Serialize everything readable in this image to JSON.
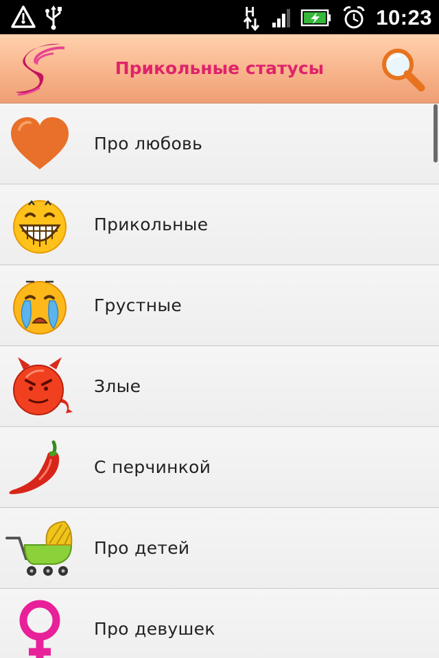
{
  "status_bar": {
    "time": "10:23",
    "icons": [
      "warning-icon",
      "usb-icon",
      "hspa-data-icon",
      "signal-icon",
      "battery-charging-icon",
      "alarm-icon"
    ]
  },
  "header": {
    "title": "Прикольные статусы",
    "logo_icon": "s-logo-icon",
    "search_icon": "magnifier-icon",
    "title_color": "#e0236b"
  },
  "categories": [
    {
      "label": "Про любовь",
      "icon": "heart-icon"
    },
    {
      "label": "Прикольные",
      "icon": "laughing-smiley-icon"
    },
    {
      "label": "Грустные",
      "icon": "crying-smiley-icon"
    },
    {
      "label": "Злые",
      "icon": "devil-smiley-icon"
    },
    {
      "label": "С перчинкой",
      "icon": "chili-pepper-icon"
    },
    {
      "label": "Про детей",
      "icon": "baby-stroller-icon"
    },
    {
      "label": "Про девушек",
      "icon": "female-symbol-icon"
    }
  ]
}
